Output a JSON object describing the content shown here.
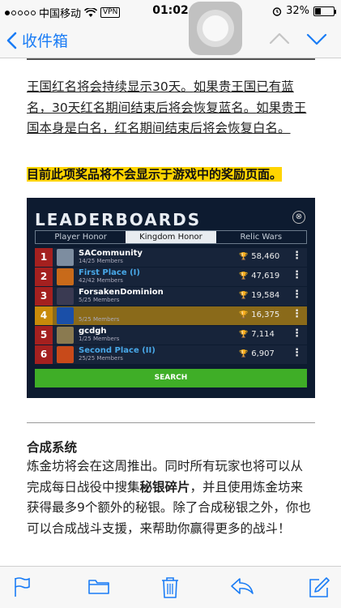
{
  "status_bar": {
    "carrier": "中国移动",
    "vpn": "VPN",
    "time": "01:02",
    "battery": "32%",
    "battery_level": 0.32
  },
  "nav": {
    "back_label": "收件箱"
  },
  "content": {
    "para1": [
      "王国红名将会持续显示30天。",
      "如果贵王国已有蓝名，",
      "30天红名期间结束后将会恢复蓝名。",
      "如果贵王国本身是白名，",
      "红名期间结束后将会恢复白名。"
    ],
    "highlight": "目前此项奖品将不会显示于游戏中的奖励页面。",
    "section_heading": "合成系统",
    "para2_a": "炼金坊将会在这周推出。同时所有玩家也将可以从完成每日战役中搜集",
    "para2_bold": "秘银碎片",
    "para2_b": "，并且使用炼金坊来获得最多9个额外的秘银。除了合成秘银之外，你也可以合成战斗支援，来帮助你赢得更多的战斗！"
  },
  "game": {
    "title": "LEADERBOARDS",
    "close": "⊗",
    "tabs": [
      "Player Honor",
      "Kingdom Honor",
      "Relic Wars"
    ],
    "active_tab": 1,
    "rows": [
      {
        "rank": "1",
        "name": "SACommunity",
        "members": "14/25 Members",
        "score": "58,460",
        "blue": false
      },
      {
        "rank": "2",
        "name": "First Place (I)",
        "members": "42/42 Members",
        "score": "47,619",
        "blue": true
      },
      {
        "rank": "3",
        "name": "ForsakenDominion",
        "members": "5/25 Members",
        "score": "19,584",
        "blue": false
      },
      {
        "rank": "4",
        "name": "",
        "members": "5/25 Members",
        "score": "16,375",
        "blue": false
      },
      {
        "rank": "5",
        "name": "gcdgh",
        "members": "1/25 Members",
        "score": "7,114",
        "blue": false
      },
      {
        "rank": "6",
        "name": "Second Place (II)",
        "members": "25/25 Members",
        "score": "6,907",
        "blue": true
      }
    ],
    "search_label": "SEARCH"
  },
  "colors": {
    "ios_blue": "#1a7cf5",
    "highlight": "#ffd400",
    "rank_red": "#a4201f",
    "search_green": "#3fae27"
  },
  "toolbar": {
    "icons": [
      "flag-icon",
      "folder-icon",
      "trash-icon",
      "reply-icon",
      "compose-icon"
    ]
  }
}
